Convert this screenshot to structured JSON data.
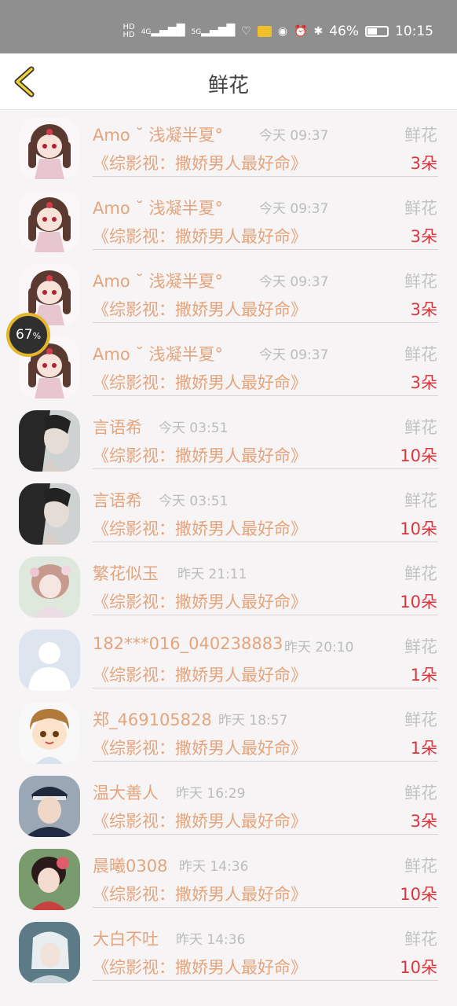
{
  "status_bar": {
    "hd1": "HD",
    "hd2": "HD",
    "net1": "4G",
    "net2": "5G",
    "battery": "46%",
    "time": "10:15"
  },
  "header": {
    "title": "鲜花"
  },
  "floating": {
    "progress": "67",
    "unit": "%"
  },
  "rows": [
    {
      "name": "Amo ˘ 浅凝半夏°",
      "time": "今天 09:37",
      "label": "鲜花",
      "book": "《综影视：撒娇男人最好命》",
      "count": "3朵",
      "avatar": "anime-girl-red"
    },
    {
      "name": "Amo ˘ 浅凝半夏°",
      "time": "今天 09:37",
      "label": "鲜花",
      "book": "《综影视：撒娇男人最好命》",
      "count": "3朵",
      "avatar": "anime-girl-red"
    },
    {
      "name": "Amo ˘ 浅凝半夏°",
      "time": "今天 09:37",
      "label": "鲜花",
      "book": "《综影视：撒娇男人最好命》",
      "count": "3朵",
      "avatar": "anime-girl-red"
    },
    {
      "name": "Amo ˘ 浅凝半夏°",
      "time": "今天 09:37",
      "label": "鲜花",
      "book": "《综影视：撒娇男人最好命》",
      "count": "3朵",
      "avatar": "anime-girl-red"
    },
    {
      "name": "言语希",
      "time": "今天 03:51",
      "label": "鲜花",
      "book": "《综影视：撒娇男人最好命》",
      "count": "10朵",
      "avatar": "dark-girl"
    },
    {
      "name": "言语希",
      "time": "今天 03:51",
      "label": "鲜花",
      "book": "《综影视：撒娇男人最好命》",
      "count": "10朵",
      "avatar": "dark-girl"
    },
    {
      "name": "繁花似玉",
      "time": "昨天 21:11",
      "label": "鲜花",
      "book": "《综影视：撒娇男人最好命》",
      "count": "10朵",
      "avatar": "flower-girl"
    },
    {
      "name": "182***016_040238883",
      "time": "昨天 20:10",
      "label": "鲜花",
      "book": "《综影视：撒娇男人最好命》",
      "count": "1朵",
      "avatar": "default-user"
    },
    {
      "name": "郑_469105828",
      "time": "昨天 18:57",
      "label": "鲜花",
      "book": "《综影视：撒娇男人最好命》",
      "count": "1朵",
      "avatar": "cartoon-boy"
    },
    {
      "name": "温大善人",
      "time": "昨天 16:29",
      "label": "鲜花",
      "book": "《综影视：撒娇男人最好命》",
      "count": "3朵",
      "avatar": "police-boy"
    },
    {
      "name": "晨曦0308",
      "time": "昨天 14:36",
      "label": "鲜花",
      "book": "《综影视：撒娇男人最好命》",
      "count": "10朵",
      "avatar": "painted-girl"
    },
    {
      "name": "大白不吐",
      "time": "昨天 14:36",
      "label": "鲜花",
      "book": "《综影视：撒娇男人最好命》",
      "count": "10朵",
      "avatar": "white-hair"
    }
  ]
}
